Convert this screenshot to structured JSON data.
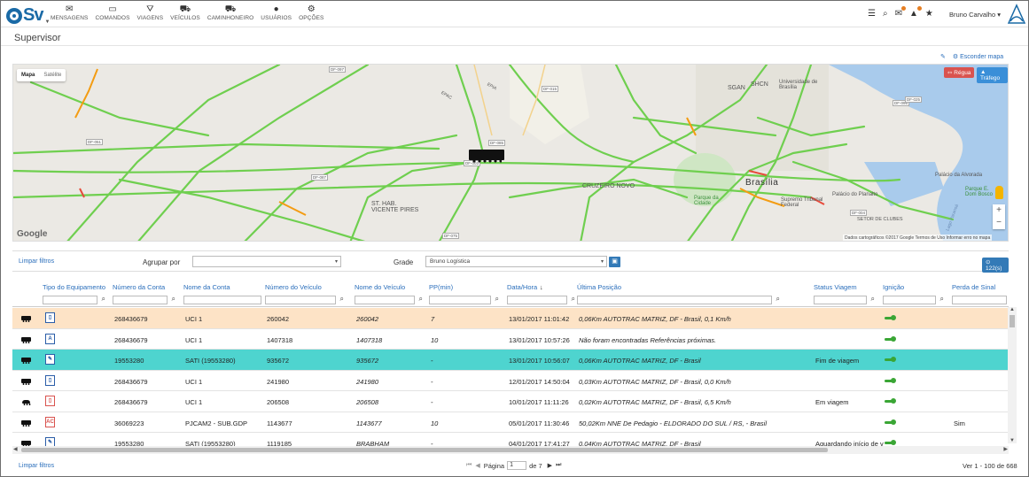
{
  "app": {
    "logo_text": "Sv",
    "menu": [
      {
        "label": "MENSAGENS",
        "icon": "envelope-icon"
      },
      {
        "label": "COMANDOS",
        "icon": "laptop-icon"
      },
      {
        "label": "VIAGENS",
        "icon": "road-icon"
      },
      {
        "label": "VEÍCULOS",
        "icon": "car-icon"
      },
      {
        "label": "CAMINHONEIRO",
        "icon": "truck-icon"
      },
      {
        "label": "USUÁRIOS",
        "icon": "user-icon"
      },
      {
        "label": "OPÇÕES",
        "icon": "cogs-icon"
      }
    ],
    "user_name": "Bruno Carvalho"
  },
  "page": {
    "title": "Supervisor",
    "hide_map": "Esconder mapa"
  },
  "map": {
    "type_map": "Mapa",
    "type_satellite": "Satélite",
    "regua": "Régua",
    "trafego": "Tráfego",
    "google": "Google",
    "attribution": "Dados cartográficos ©2017 Google   Termos de Uso   Informar erro no mapa",
    "labels": {
      "brasilia": "Brasília",
      "cruzeiro": "CRUZEIRO NOVO",
      "sgan": "SGAN",
      "shcn": "SHCN",
      "unb": "Universidade de Brasília",
      "sthab": "ST. HAB. VICENTE PIRES",
      "parque_cidade": "Parque da Cidade",
      "planalto": "Palácio do Planalto",
      "stf": "Supremo Tribunal Federal",
      "clubes": "SETOR DE CLUBES",
      "alvorada": "Palácio da Alvorada",
      "dom_bosco": "Parque E. Dom Bosco",
      "lago": "Lago Paranoá",
      "epac": "EPAC",
      "epia": "EPIA"
    },
    "shields": [
      "DF-097",
      "DF-085",
      "DF-087",
      "DF-003",
      "DF-075",
      "DF-051",
      "DF-015",
      "DF-095",
      "DF-004",
      "DF-025"
    ]
  },
  "filter": {
    "clear_label": "Limpar filtros",
    "group_label": "Agrupar por",
    "group_value": "",
    "grid_label": "Grade",
    "grid_value": "Bruno Logística",
    "count_label": "122(s)"
  },
  "table": {
    "columns": [
      "Tipo do Equipamento",
      "Número da Conta",
      "Nome da Conta",
      "Número do Veículo",
      "Nome do Veículo",
      "PP(min)",
      "Data/Hora",
      "Última Posição",
      "Status Viagem",
      "Ignição",
      "Perda de Sinal"
    ],
    "rows": [
      {
        "vehicle": "truck",
        "equip": "▯",
        "equip_color": "blue",
        "conta": "268436679",
        "nome_conta": "UCI 1",
        "num_veiculo": "260042",
        "nome_veiculo": "260042",
        "pp": "7",
        "data": "13/01/2017 11:01:42",
        "posicao": "0,06Km AUTOTRAC MATRIZ, DF - Brasil, 0,1 Km/h",
        "status": "",
        "perda": "",
        "bg": "#fde3c6"
      },
      {
        "vehicle": "truck",
        "equip": "A",
        "equip_color": "blue",
        "conta": "268436679",
        "nome_conta": "UCI 1",
        "num_veiculo": "1407318",
        "nome_veiculo": "1407318",
        "pp": "10",
        "data": "13/01/2017 10:57:26",
        "posicao": "Não foram encontradas Referências próximas.",
        "status": "",
        "perda": "",
        "bg": "#ffffff"
      },
      {
        "vehicle": "truck",
        "equip": "✎",
        "equip_color": "blue",
        "conta": "19553280",
        "nome_conta": "SATI (19553280)",
        "num_veiculo": "935672",
        "nome_veiculo": "935672",
        "pp": "-",
        "data": "13/01/2017 10:56:07",
        "posicao": "0,06Km AUTOTRAC MATRIZ, DF - Brasil",
        "status": "Fim de viagem",
        "perda": "",
        "bg": "#4ed4cf"
      },
      {
        "vehicle": "truck",
        "equip": "▯",
        "equip_color": "blue",
        "conta": "268436679",
        "nome_conta": "UCI 1",
        "num_veiculo": "241980",
        "nome_veiculo": "241980",
        "pp": "-",
        "data": "12/01/2017 14:50:04",
        "posicao": "0,03Km AUTOTRAC MATRIZ, DF - Brasil, 0,0 Km/h",
        "status": "",
        "perda": "",
        "bg": "#ffffff"
      },
      {
        "vehicle": "car",
        "equip": "▯",
        "equip_color": "red",
        "conta": "268436679",
        "nome_conta": "UCI 1",
        "num_veiculo": "206508",
        "nome_veiculo": "206508",
        "pp": "-",
        "data": "10/01/2017 11:11:26",
        "posicao": "0,02Km AUTOTRAC MATRIZ, DF - Brasil, 6,5 Km/h",
        "status": "Em viagem",
        "perda": "",
        "bg": "#ffffff"
      },
      {
        "vehicle": "truck",
        "equip": "AC",
        "equip_color": "red",
        "conta": "36069223",
        "nome_conta": "PJCAM2 - SUB.GDP",
        "num_veiculo": "1143677",
        "nome_veiculo": "1143677",
        "pp": "10",
        "data": "05/01/2017 11:30:46",
        "posicao": "50,02Km NNE De Pedagio - ELDORADO DO SUL / RS, - Brasil",
        "status": "",
        "perda": "Sim",
        "bg": "#ffffff"
      },
      {
        "vehicle": "truck",
        "equip": "✎",
        "equip_color": "blue",
        "conta": "19553280",
        "nome_conta": "SATI (19553280)",
        "num_veiculo": "1119185",
        "nome_veiculo": "BRABHAM",
        "pp": "-",
        "data": "04/01/2017 17:41:27",
        "posicao": "0,04Km AUTOTRAC MATRIZ, DF - Brasil",
        "status": "Aguardando início de v",
        "perda": "",
        "bg": "#ffffff"
      }
    ]
  },
  "footer": {
    "clear_label": "Limpar filtros",
    "page_label": "Página",
    "page_value": "1",
    "of_label": "de 7",
    "view_count": "Ver 1 - 100 de 668"
  }
}
